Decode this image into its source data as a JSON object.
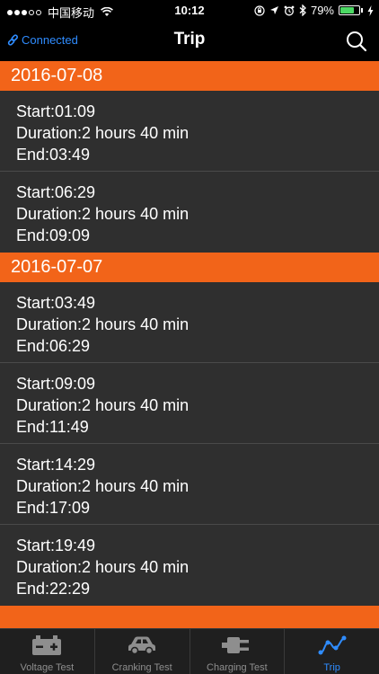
{
  "status_bar": {
    "carrier": "中国移动",
    "time": "10:12",
    "battery": "79%",
    "battery_level": 0.79
  },
  "header": {
    "connection_status": "Connected",
    "title": "Trip",
    "search_icon": "search-icon"
  },
  "sections": [
    {
      "date": "2016-07-08",
      "trips": [
        {
          "start": "Start:01:09",
          "duration": "Duration:2 hours 40 min",
          "end": "End:03:49"
        },
        {
          "start": "Start:06:29",
          "duration": "Duration:2 hours 40 min",
          "end": "End:09:09"
        }
      ]
    },
    {
      "date": "2016-07-07",
      "trips": [
        {
          "start": "Start:03:49",
          "duration": "Duration:2 hours 40 min",
          "end": "End:06:29"
        },
        {
          "start": "Start:09:09",
          "duration": "Duration:2 hours 40 min",
          "end": "End:11:49"
        },
        {
          "start": "Start:14:29",
          "duration": "Duration:2 hours 40 min",
          "end": "End:17:09"
        },
        {
          "start": "Start:19:49",
          "duration": "Duration:2 hours 40 min",
          "end": "End:22:29"
        }
      ]
    }
  ],
  "tab_bar": {
    "tabs": [
      {
        "label": "Voltage Test",
        "icon": "battery-icon",
        "active": false
      },
      {
        "label": "Cranking Test",
        "icon": "car-icon",
        "active": false
      },
      {
        "label": "Charging Test",
        "icon": "plug-icon",
        "active": false
      },
      {
        "label": "Trip",
        "icon": "trip-route-icon",
        "active": true
      }
    ]
  },
  "colors": {
    "section_header": "#f26419",
    "accent": "#2f8cff",
    "background": "#2f2f2f"
  }
}
